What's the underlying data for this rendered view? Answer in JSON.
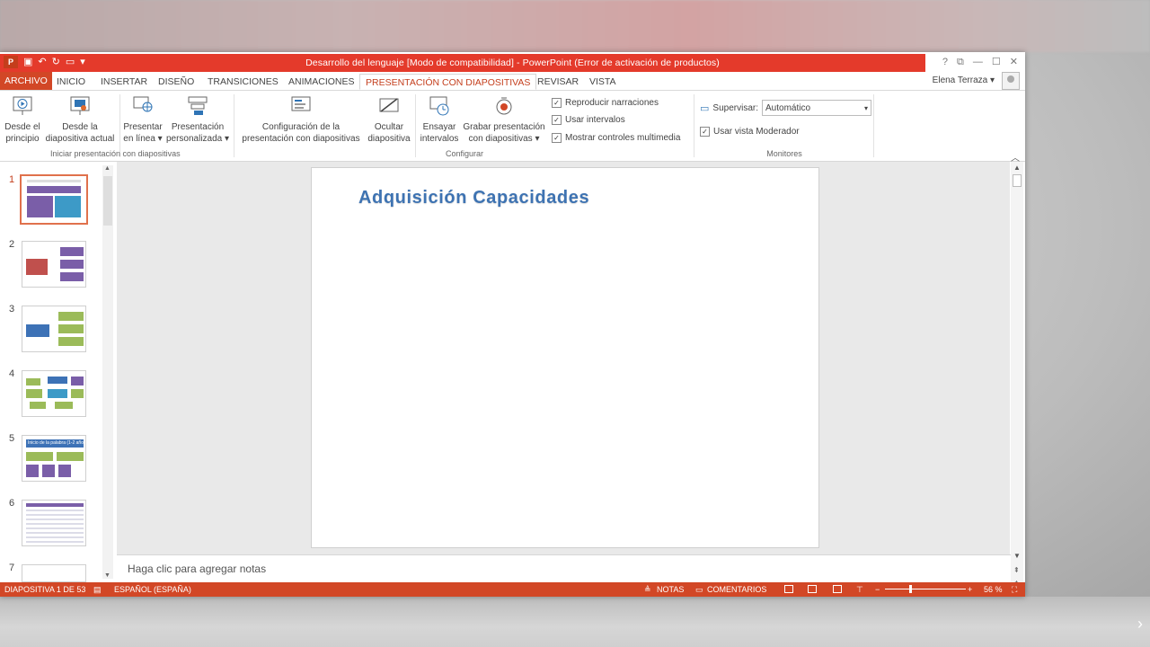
{
  "window": {
    "title": "Desarrollo del lenguaje [Modo de compatibilidad] - PowerPoint (Error de activación de productos)",
    "app_icon": "P",
    "controls": [
      "?",
      "⧉",
      "—",
      "☐",
      "✕"
    ]
  },
  "tabs": {
    "file": "ARCHIVO",
    "items": [
      "INICIO",
      "INSERTAR",
      "DISEÑO",
      "TRANSICIONES",
      "ANIMACIONES",
      "PRESENTACIÓN CON DIAPOSITIVAS",
      "REVISAR",
      "VISTA"
    ],
    "active": "PRESENTACIÓN CON DIAPOSITIVAS"
  },
  "user": {
    "name": "Elena Terraza ▾"
  },
  "ribbon": {
    "buttons": [
      {
        "l1": "Desde el",
        "l2": "principio"
      },
      {
        "l1": "Desde la",
        "l2": "diapositiva actual"
      },
      {
        "l1": "Presentar",
        "l2": "en línea ▾"
      },
      {
        "l1": "Presentación",
        "l2": "personalizada ▾"
      },
      {
        "l1": "Configuración de la",
        "l2": "presentación con diapositivas"
      },
      {
        "l1": "Ocultar",
        "l2": "diapositiva"
      },
      {
        "l1": "Ensayar",
        "l2": "intervalos"
      },
      {
        "l1": "Grabar presentación",
        "l2": "con diapositivas ▾"
      }
    ],
    "checks": [
      {
        "label": "Reproducir narraciones",
        "checked": true
      },
      {
        "label": "Usar intervalos",
        "checked": true
      },
      {
        "label": "Mostrar controles multimedia",
        "checked": true
      }
    ],
    "groups": [
      "Iniciar presentación con diapositivas",
      "Configurar",
      "Monitores"
    ],
    "monitors": {
      "supervisar_label": "Supervisar:",
      "supervisar_value": "Automático",
      "presenter_view": "Usar vista Moderador"
    }
  },
  "thumbnails": {
    "numbers": [
      "1",
      "2",
      "3",
      "4",
      "5",
      "6",
      "7"
    ],
    "selected": 1,
    "thumb5_title": "Inicio de la palabra (1-2 años)"
  },
  "slide": {
    "title": "Adquisición Capacidades"
  },
  "notes": {
    "placeholder": "Haga clic para agregar notas"
  },
  "status": {
    "slide_count": "DIAPOSITIVA 1 DE 53",
    "language": "ESPAÑOL (ESPAÑA)",
    "notes": "NOTAS",
    "comments": "COMENTARIOS",
    "zoom": "56 %"
  },
  "colors": {
    "accent": "#d24726",
    "title_bar": "#e43a2b",
    "slide_title": "#3e73b2"
  }
}
